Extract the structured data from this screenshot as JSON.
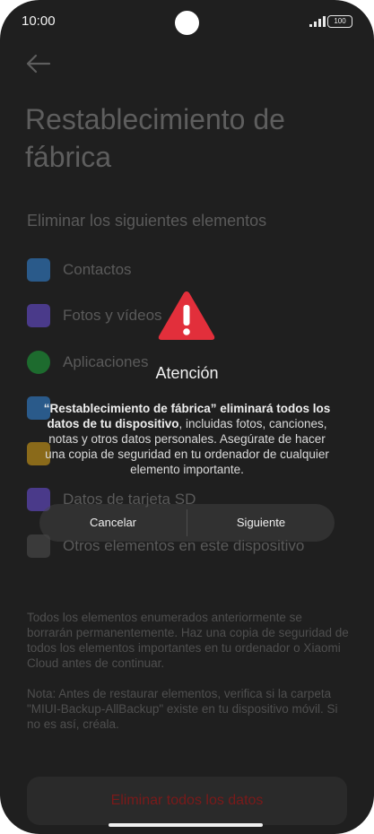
{
  "status_bar": {
    "time": "10:00",
    "battery": "100"
  },
  "page": {
    "title": "Restablecimiento de fábrica",
    "section_title": "Eliminar los siguientes elementos",
    "items": [
      {
        "label": "Contactos",
        "icon": "contacts-icon",
        "color": "#2a5a8a"
      },
      {
        "label": "Fotos y vídeos",
        "icon": "gallery-icon",
        "color": "#4a3a8a"
      },
      {
        "label": "Aplicaciones",
        "icon": "apps-icon",
        "color": "#1d6b2e"
      },
      {
        "label": "",
        "icon": "accounts-icon",
        "color": "#2a5a8a"
      },
      {
        "label": "",
        "icon": "data-icon",
        "color": "#8a6a1a"
      },
      {
        "label": "Datos de tarjeta SD",
        "icon": "sd-card-icon",
        "color": "#4a3a8a"
      },
      {
        "label": "Otros elementos en este dispositivo",
        "icon": "other-items-icon",
        "color": "#3a3a3a"
      }
    ],
    "description": "Todos los elementos enumerados anteriormente se borrarán permanentemente. Haz una copia de seguridad de todos los elementos importantes en tu ordenador o Xiaomi Cloud antes de continuar.",
    "note": "Nota: Antes de restaurar elementos, verifica si la carpeta \"MIUI-Backup-AllBackup\" existe en tu dispositivo móvil. Si no es así, créala.",
    "erase_button": "Eliminar todos los datos"
  },
  "dialog": {
    "title": "Atención",
    "message_bold": "“Restablecimiento de fábrica” eliminará todos los datos de tu dispositivo",
    "message_rest": ", incluidas fotos, canciones, notas y otros datos personales. Asegúrate de hacer una copia de seguridad en tu ordenador de cualquier elemento importante.",
    "cancel": "Cancelar",
    "next": "Siguiente",
    "warning_color": "#e22f3b"
  }
}
